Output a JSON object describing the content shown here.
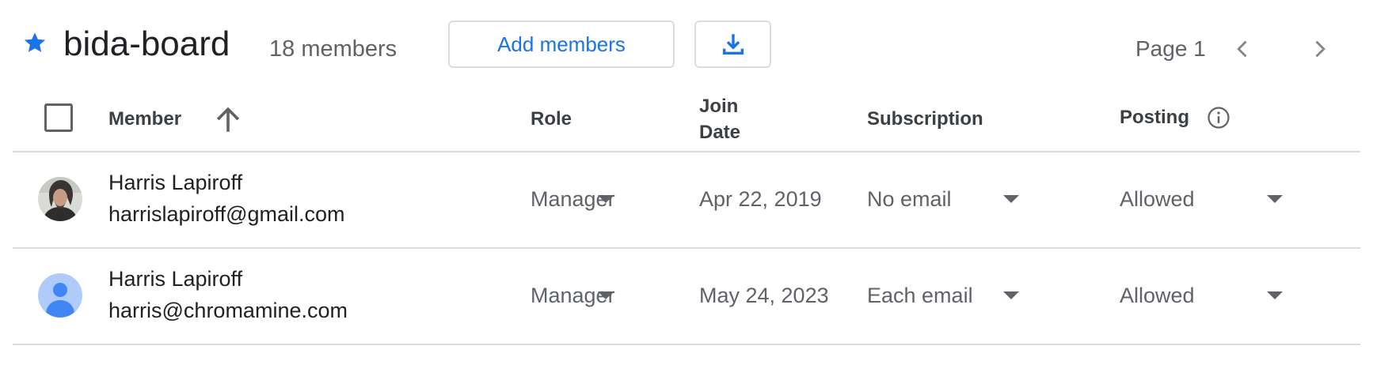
{
  "header": {
    "group_name": "bida-board",
    "member_count": "18 members",
    "add_members_label": "Add members",
    "page_label": "Page 1"
  },
  "columns": {
    "member": "Member",
    "role": "Role",
    "join_date": "Join Date",
    "subscription": "Subscription",
    "posting": "Posting"
  },
  "rows": [
    {
      "name": "Harris Lapiroff",
      "email": "harrislapiroff@gmail.com",
      "role": "Manager",
      "join_date": "Apr 22, 2019",
      "subscription": "No email",
      "posting": "Allowed"
    },
    {
      "name": "Harris Lapiroff",
      "email": "harris@chromamine.com",
      "role": "Manager",
      "join_date": "May 24, 2023",
      "subscription": "Each email",
      "posting": "Allowed"
    }
  ],
  "colors": {
    "accent": "#1a73e8",
    "text": "#202124",
    "muted": "#5f6368",
    "divider": "#dadce0",
    "default_avatar_bg": "#aecbfa",
    "default_avatar_fg": "#4285f4"
  }
}
